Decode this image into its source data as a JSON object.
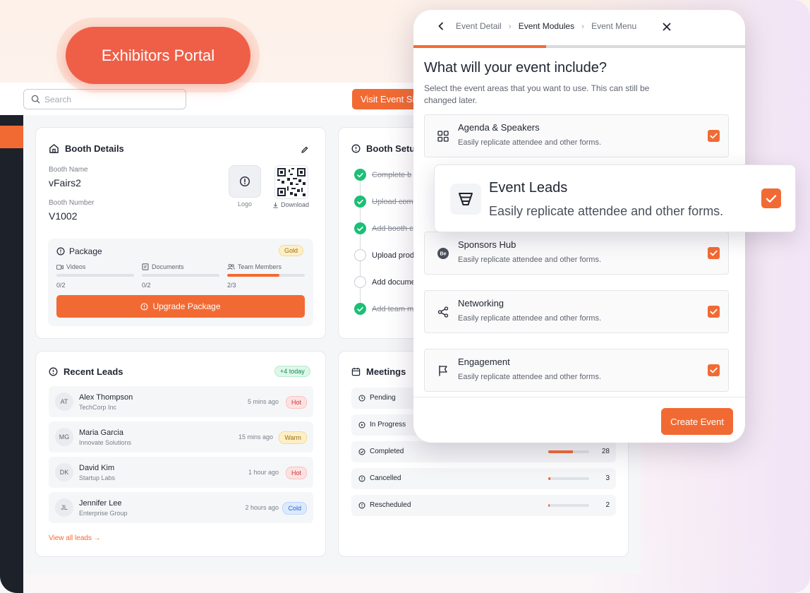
{
  "portal_badge": "Exhibitors Portal",
  "search": {
    "placeholder": "Search"
  },
  "visit_button": "Visit Event Site",
  "booth_details": {
    "title": "Booth Details",
    "booth_name_label": "Booth Name",
    "booth_name": "vFairs2",
    "booth_number_label": "Booth Number",
    "booth_number": "V1002",
    "logo_label": "Logo",
    "download_label": "Download",
    "package": {
      "title": "Package",
      "tier": "Gold",
      "items": [
        {
          "label": "Videos",
          "count": "0/2",
          "progress": 0
        },
        {
          "label": "Documents",
          "count": "0/2",
          "progress": 0
        },
        {
          "label": "Team Members",
          "count": "2/3",
          "progress": 0.67
        }
      ],
      "upgrade_button": "Upgrade Package"
    }
  },
  "booth_setup": {
    "title": "Booth Setup",
    "steps": [
      {
        "label": "Complete b",
        "done": true
      },
      {
        "label": "Upload com",
        "done": true
      },
      {
        "label": "Add booth c",
        "done": true
      },
      {
        "label": "Upload prod",
        "done": false
      },
      {
        "label": "Add docume",
        "done": false
      },
      {
        "label": "Add team m",
        "done": true
      }
    ]
  },
  "recent_leads": {
    "title": "Recent Leads",
    "badge": "+4 today",
    "items": [
      {
        "initials": "AT",
        "name": "Alex Thompson",
        "company": "TechCorp Inc",
        "time": "5 mins ago",
        "tag": "Hot"
      },
      {
        "initials": "MG",
        "name": "Maria Garcia",
        "company": "Innovate Solutions",
        "time": "15 mins ago",
        "tag": "Warm"
      },
      {
        "initials": "DK",
        "name": "David Kim",
        "company": "Startup Labs",
        "time": "1 hour ago",
        "tag": "Hot"
      },
      {
        "initials": "JL",
        "name": "Jennifer Lee",
        "company": "Enterprise Group",
        "time": "2 hours ago",
        "tag": "Cold"
      }
    ],
    "view_all": "View all leads"
  },
  "meetings": {
    "title": "Meetings",
    "rows": [
      {
        "label": "Pending",
        "count": "",
        "progress": 0
      },
      {
        "label": "In Progress",
        "count": "",
        "progress": 0
      },
      {
        "label": "Completed",
        "count": "28",
        "progress": 0.6
      },
      {
        "label": "Cancelled",
        "count": "3",
        "progress": 0.06
      },
      {
        "label": "Rescheduled",
        "count": "2",
        "progress": 0.04
      }
    ]
  },
  "modal": {
    "breadcrumbs": [
      "Event Detail",
      "Event Modules",
      "Event Menu"
    ],
    "current_step": 1,
    "progress": 0.4,
    "title": "What will your event include?",
    "description": "Select the event areas that you want to use. This can still be changed later.",
    "options": [
      {
        "title": "Agenda & Speakers",
        "desc": "Easily replicate attendee and other forms.",
        "icon": "grid-icon",
        "checked": true
      },
      {
        "title": "Sponsors Hub",
        "desc": "Easily replicate attendee and other forms.",
        "icon": "behance-icon",
        "checked": true
      },
      {
        "title": "Networking",
        "desc": "Easily replicate attendee and other forms.",
        "icon": "share-icon",
        "checked": true
      },
      {
        "title": "Engagement",
        "desc": "Easily replicate attendee and other forms.",
        "icon": "flag-icon",
        "checked": true
      }
    ],
    "create_button": "Create Event"
  },
  "floating_option": {
    "title": "Event Leads",
    "desc": "Easily replicate attendee and other forms.",
    "icon": "funnel-icon",
    "checked": true
  },
  "colors": {
    "accent": "#f26a33",
    "pill": "#ef5f48",
    "sidebar": "#1d2129",
    "success": "#1bbf76"
  }
}
